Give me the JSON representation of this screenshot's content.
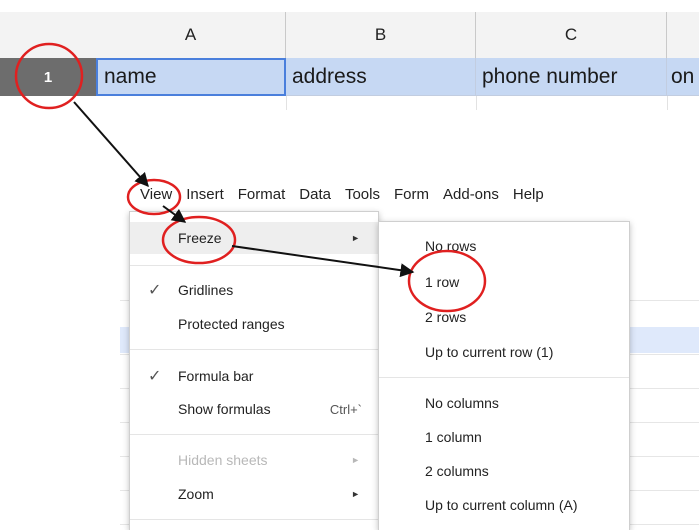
{
  "sheet": {
    "columns": [
      "A",
      "B",
      "C"
    ],
    "row_number": "1",
    "cells": [
      "name",
      "address",
      "phone number",
      "on"
    ]
  },
  "menubar": {
    "items": [
      "View",
      "Insert",
      "Format",
      "Data",
      "Tools",
      "Form",
      "Add-ons",
      "Help"
    ]
  },
  "view_menu": {
    "freeze": "Freeze",
    "gridlines": "Gridlines",
    "protected_ranges": "Protected ranges",
    "formula_bar": "Formula bar",
    "show_formulas": "Show formulas",
    "show_formulas_shortcut": "Ctrl+`",
    "hidden_sheets": "Hidden sheets",
    "zoom": "Zoom",
    "check_glyph": "✓",
    "arrow_glyph": "►"
  },
  "freeze_submenu": {
    "no_rows": "No rows",
    "one_row": "1 row",
    "two_rows": "2 rows",
    "up_to_row": "Up to current row (1)",
    "no_columns": "No columns",
    "one_column": "1 column",
    "two_columns": "2 columns",
    "up_to_column": "Up to current column (A)"
  },
  "colors": {
    "selection_fill": "#c6d8f3",
    "selection_border": "#4a7fdc",
    "row_header_active": "#6d6d6d",
    "annotation_red": "#e02020"
  },
  "icons": [
    "check-icon",
    "submenu-arrow-icon"
  ]
}
